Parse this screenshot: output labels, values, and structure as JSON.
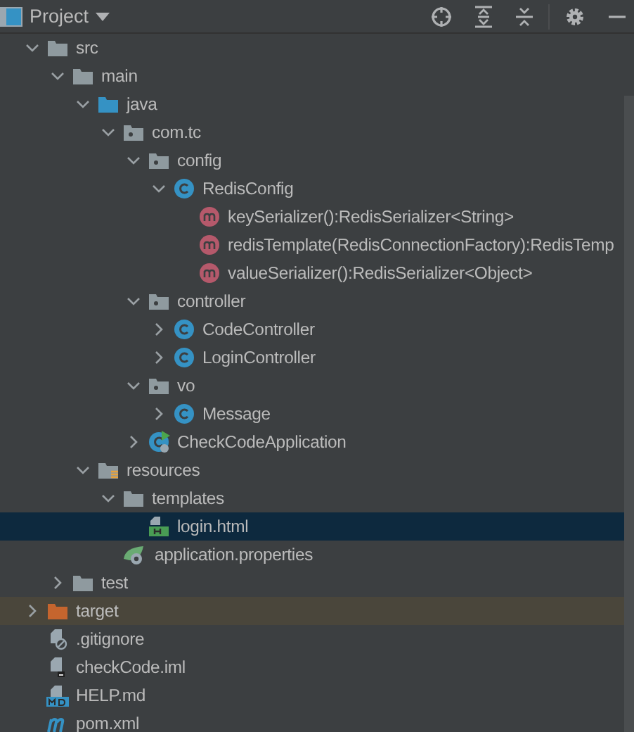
{
  "header": {
    "title": "Project"
  },
  "tree": [
    {
      "name": "src",
      "kind": "folder",
      "expanded": true,
      "selected": false,
      "children": [
        {
          "name": "main",
          "kind": "folder",
          "expanded": true,
          "selected": false,
          "children": [
            {
              "name": "java",
              "kind": "source-folder",
              "expanded": true,
              "selected": false,
              "children": [
                {
                  "name": "com.tc",
                  "kind": "package",
                  "expanded": true,
                  "selected": false,
                  "children": [
                    {
                      "name": "config",
                      "kind": "package",
                      "expanded": true,
                      "selected": false,
                      "children": [
                        {
                          "name": "RedisConfig",
                          "kind": "class",
                          "expanded": true,
                          "selected": false,
                          "children": [
                            {
                              "name": "keySerializer():RedisSerializer<String>",
                              "kind": "method",
                              "selected": false
                            },
                            {
                              "name": "redisTemplate(RedisConnectionFactory):RedisTemp",
                              "kind": "method",
                              "selected": false
                            },
                            {
                              "name": "valueSerializer():RedisSerializer<Object>",
                              "kind": "method",
                              "selected": false
                            }
                          ]
                        }
                      ]
                    },
                    {
                      "name": "controller",
                      "kind": "package",
                      "expanded": true,
                      "selected": false,
                      "children": [
                        {
                          "name": "CodeController",
                          "kind": "class",
                          "expanded": false,
                          "selected": false
                        },
                        {
                          "name": "LoginController",
                          "kind": "class",
                          "expanded": false,
                          "selected": false
                        }
                      ]
                    },
                    {
                      "name": "vo",
                      "kind": "package",
                      "expanded": true,
                      "selected": false,
                      "children": [
                        {
                          "name": "Message",
                          "kind": "class",
                          "expanded": false,
                          "selected": false
                        }
                      ]
                    },
                    {
                      "name": "CheckCodeApplication",
                      "kind": "app-class",
                      "expanded": false,
                      "selected": false
                    }
                  ]
                }
              ]
            },
            {
              "name": "resources",
              "kind": "resources-folder",
              "expanded": true,
              "selected": false,
              "children": [
                {
                  "name": "templates",
                  "kind": "folder",
                  "expanded": true,
                  "selected": false,
                  "children": [
                    {
                      "name": "login.html",
                      "kind": "html",
                      "selected": true
                    }
                  ]
                },
                {
                  "name": "application.properties",
                  "kind": "properties",
                  "selected": false
                }
              ]
            }
          ]
        },
        {
          "name": "test",
          "kind": "folder",
          "expanded": false,
          "selected": false
        }
      ]
    },
    {
      "name": "target",
      "kind": "excluded-folder",
      "expanded": false,
      "selected": false
    },
    {
      "name": ".gitignore",
      "kind": "ignore-file",
      "selected": false
    },
    {
      "name": "checkCode.iml",
      "kind": "module-file",
      "selected": false
    },
    {
      "name": "HELP.md",
      "kind": "markdown-file",
      "selected": false
    },
    {
      "name": "pom.xml",
      "kind": "maven-file",
      "selected": false
    }
  ]
}
